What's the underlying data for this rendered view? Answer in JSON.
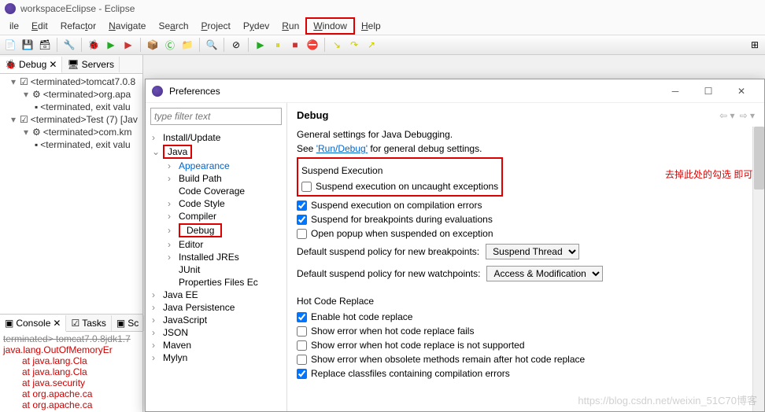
{
  "window": {
    "title": "workspaceEclipse - Eclipse"
  },
  "menu": {
    "file": "ile",
    "edit": "Edit",
    "refactor": "Refactor",
    "navigate": "Navigate",
    "search": "Search",
    "project": "Project",
    "pydev": "Pydev",
    "run": "Run",
    "window": "Window",
    "help": "Help"
  },
  "debug_view": {
    "tab_debug": "Debug",
    "tab_servers": "Servers",
    "items": [
      "<terminated>tomcat7.0.8",
      "<terminated>org.apa",
      "<terminated, exit valu",
      "<terminated>Test (7) [Jav",
      "<terminated>com.km",
      "<terminated, exit valu"
    ]
  },
  "console": {
    "tab_console": "Console",
    "tab_tasks": "Tasks",
    "tab_sc": "Sc",
    "header": "terminated> tomcat7.0.8jdk1.7",
    "lines": [
      "java.lang.OutOfMemoryEr",
      "at java.lang.Cla",
      "at java.lang.Cla",
      "at java.security",
      "at org.apache.ca",
      "at org.apache.ca"
    ]
  },
  "prefs": {
    "title": "Preferences",
    "filter_placeholder": "type filter text",
    "tree": {
      "install": "Install/Update",
      "java": "Java",
      "java_children": [
        "Appearance",
        "Build Path",
        "Code Coverage",
        "Code Style",
        "Compiler",
        "Debug",
        "Editor",
        "Installed JREs",
        "JUnit",
        "Properties Files Ec"
      ],
      "others": [
        "Java EE",
        "Java Persistence",
        "JavaScript",
        "JSON",
        "Maven",
        "Mylyn"
      ]
    },
    "page": {
      "title": "Debug",
      "desc1": "General settings for Java Debugging.",
      "desc2a": "See ",
      "desc2_link": "'Run/Debug'",
      "desc2b": " for general debug settings.",
      "annotation": "去掉此处的勾选 即可",
      "suspend_group": "Suspend Execution",
      "checks": {
        "c1": "Suspend execution on uncaught exceptions",
        "c2": "Suspend execution on compilation errors",
        "c3": "Suspend for breakpoints during evaluations",
        "c4": "Open popup when suspended on exception"
      },
      "bp_label": "Default suspend policy for new breakpoints:",
      "bp_value": "Suspend Thread",
      "wp_label": "Default suspend policy for new watchpoints:",
      "wp_value": "Access & Modification",
      "hot_group": "Hot Code Replace",
      "hot": {
        "h1": "Enable hot code replace",
        "h2": "Show error when hot code replace fails",
        "h3": "Show error when hot code replace is not supported",
        "h4": "Show error when obsolete methods remain after hot code replace",
        "h5": "Replace classfiles containing compilation errors"
      }
    }
  },
  "watermark": "https://blog.csdn.net/weixin_51C70博客"
}
